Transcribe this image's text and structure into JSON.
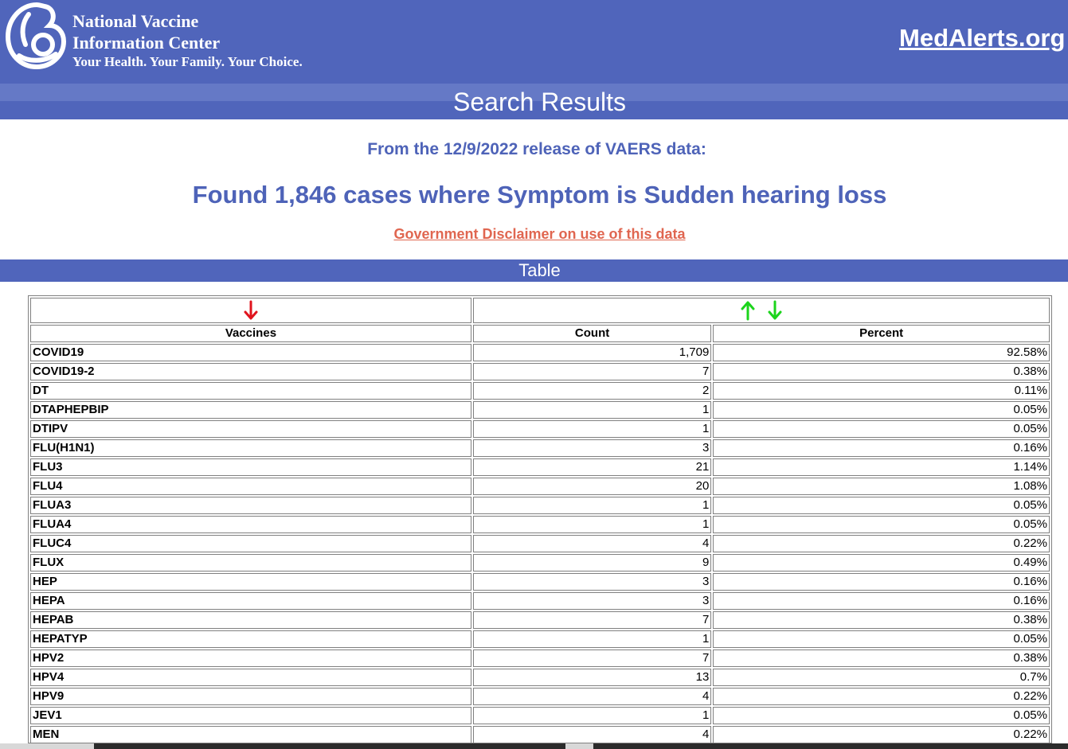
{
  "header": {
    "org_line1": "National Vaccine",
    "org_line2": "Information Center",
    "tagline": "Your Health. Your Family. Your Choice.",
    "site_link": "MedAlerts.org",
    "logo_icon": "nvic-mother-child-logo-icon"
  },
  "results": {
    "title": "Search Results",
    "release": "From the 12/9/2022 release of VAERS data:",
    "found": "Found 1,846 cases where Symptom is Sudden hearing loss",
    "disclaimer": "Government Disclaimer on use of this data"
  },
  "table": {
    "section_label": "Table",
    "sort_icons": {
      "vaccines": "sort-down-red-icon",
      "count_up": "sort-up-green-icon",
      "count_down": "sort-down-green-icon"
    },
    "colors": {
      "red_arrow": "#e0141e",
      "green_arrow": "#1cd41c"
    },
    "columns": [
      "Vaccines",
      "Count",
      "Percent"
    ],
    "rows": [
      {
        "vaccine": "COVID19",
        "count": "1,709",
        "percent": "92.58%"
      },
      {
        "vaccine": "COVID19-2",
        "count": "7",
        "percent": "0.38%"
      },
      {
        "vaccine": "DT",
        "count": "2",
        "percent": "0.11%"
      },
      {
        "vaccine": "DTAPHEPBIP",
        "count": "1",
        "percent": "0.05%"
      },
      {
        "vaccine": "DTIPV",
        "count": "1",
        "percent": "0.05%"
      },
      {
        "vaccine": "FLU(H1N1)",
        "count": "3",
        "percent": "0.16%"
      },
      {
        "vaccine": "FLU3",
        "count": "21",
        "percent": "1.14%"
      },
      {
        "vaccine": "FLU4",
        "count": "20",
        "percent": "1.08%"
      },
      {
        "vaccine": "FLUA3",
        "count": "1",
        "percent": "0.05%"
      },
      {
        "vaccine": "FLUA4",
        "count": "1",
        "percent": "0.05%"
      },
      {
        "vaccine": "FLUC4",
        "count": "4",
        "percent": "0.22%"
      },
      {
        "vaccine": "FLUX",
        "count": "9",
        "percent": "0.49%"
      },
      {
        "vaccine": "HEP",
        "count": "3",
        "percent": "0.16%"
      },
      {
        "vaccine": "HEPA",
        "count": "3",
        "percent": "0.16%"
      },
      {
        "vaccine": "HEPAB",
        "count": "7",
        "percent": "0.38%"
      },
      {
        "vaccine": "HEPATYP",
        "count": "1",
        "percent": "0.05%"
      },
      {
        "vaccine": "HPV2",
        "count": "7",
        "percent": "0.38%"
      },
      {
        "vaccine": "HPV4",
        "count": "13",
        "percent": "0.7%"
      },
      {
        "vaccine": "HPV9",
        "count": "4",
        "percent": "0.22%"
      },
      {
        "vaccine": "JEV1",
        "count": "1",
        "percent": "0.05%"
      },
      {
        "vaccine": "MEN",
        "count": "4",
        "percent": "0.22%"
      }
    ]
  },
  "brand": {
    "primary": "#5065bb",
    "stripe": "#6579c6",
    "heading_text": "#4e63b8",
    "link_red": "#e06650"
  }
}
